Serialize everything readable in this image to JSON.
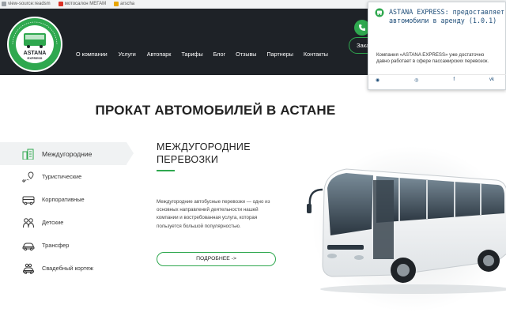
{
  "bookmarks": [
    {
      "label": "view-source:readsm",
      "color": "#9aa0a6"
    },
    {
      "label": "мотосалон МЕГАМ",
      "color": "#d93025"
    },
    {
      "label": "arscha",
      "color": "#e8a500"
    }
  ],
  "header": {
    "logo": {
      "brand": "ASTANA",
      "sub": "EXPRESS",
      "ring_text": "ТРАНСПОРТНАЯ КОМПАНИЯ"
    },
    "nav": [
      "О компании",
      "Услуги",
      "Автопарк",
      "Тарифы",
      "Блог",
      "Отзывы",
      "Партнеры",
      "Контакты"
    ],
    "cta": "Заказать"
  },
  "popup": {
    "title": "ASTANA EXPRESS: предоставляет автомобили в аренду",
    "version": "(1.0.1)",
    "body": "Компания «ASTANA EXPRESS» уже достаточно давно работает в сфере пассажирских перевозок.",
    "icons": [
      "globe-icon",
      "instagram-icon",
      "facebook-icon",
      "vk-icon"
    ],
    "icon_glyphs": [
      "◉",
      "◎",
      "f",
      "vk"
    ]
  },
  "hero": {
    "heading": "ПРОКАТ АВТОМОБИЛЕЙ В АСТАНЕ"
  },
  "menu": [
    {
      "label": "Междугородние",
      "icon": "city-icon",
      "active": true
    },
    {
      "label": "Туристические",
      "icon": "route-pin-icon",
      "active": false
    },
    {
      "label": "Корпоративные",
      "icon": "bus-icon",
      "active": false
    },
    {
      "label": "Детские",
      "icon": "children-icon",
      "active": false
    },
    {
      "label": "Трансфер",
      "icon": "car-icon",
      "active": false
    },
    {
      "label": "Свадебный кортеж",
      "icon": "wedding-car-icon",
      "active": false
    }
  ],
  "section": {
    "title_line1": "МЕЖДУГОРОДНИЕ",
    "title_line2": "ПЕРЕВОЗКИ",
    "description": "Междугородние автобусные перевозки — одно из основных направлений деятельности нашей компании и востребованная услуга, которая пользуется большой популярностью.",
    "button": "ПОДРОБНЕЕ ->"
  },
  "colors": {
    "accent": "#2fa84f",
    "header_bg": "#1e2227",
    "popup_title": "#1f4e79"
  }
}
